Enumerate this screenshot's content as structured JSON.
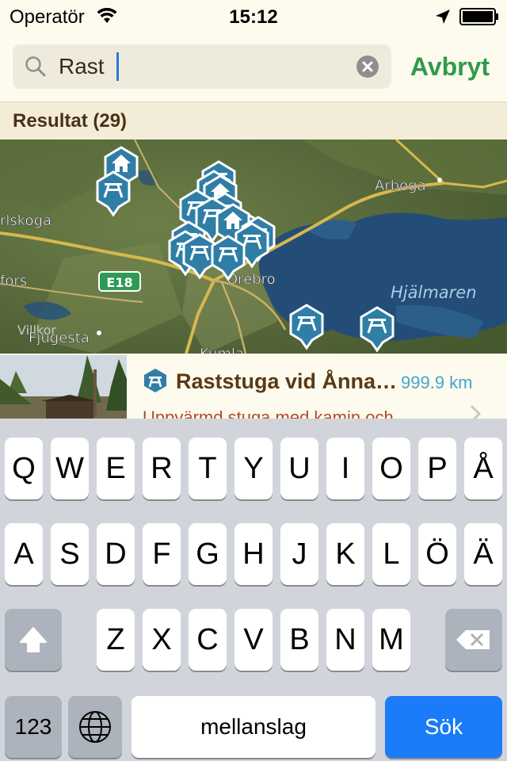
{
  "status_bar": {
    "carrier": "Operatör",
    "time": "15:12"
  },
  "search": {
    "value": "Rast",
    "cancel_label": "Avbryt"
  },
  "results": {
    "header": "Resultat (29)"
  },
  "map": {
    "labels": {
      "arboga": "Arboga",
      "karlskoga": "rlskoga",
      "fors": "fors",
      "e18": "E18",
      "orebro": "Örebro",
      "hjalmaren": "Hjälmaren",
      "villkor": "Villkor",
      "fjugesta": "Fjugesta",
      "kumla": "Kumla"
    }
  },
  "list": [
    {
      "title": "Raststuga vid Ånnaboda",
      "distance": "999.9 km",
      "description": "Uppvärmd stuga med kamin och"
    }
  ],
  "keyboard": {
    "row1": [
      "Q",
      "W",
      "E",
      "R",
      "T",
      "Y",
      "U",
      "I",
      "O",
      "P",
      "Å"
    ],
    "row2": [
      "A",
      "S",
      "D",
      "F",
      "G",
      "H",
      "J",
      "K",
      "L",
      "Ö",
      "Ä"
    ],
    "row3": [
      "Z",
      "X",
      "C",
      "V",
      "B",
      "N",
      "M"
    ],
    "numbers_label": "123",
    "space_label": "mellanslag",
    "search_label": "Sök"
  },
  "colors": {
    "accent_green": "#2f9a4a",
    "pin_blue": "#2f7ea6",
    "distance_blue": "#43a6cf",
    "search_key_blue": "#1a7cf8"
  }
}
